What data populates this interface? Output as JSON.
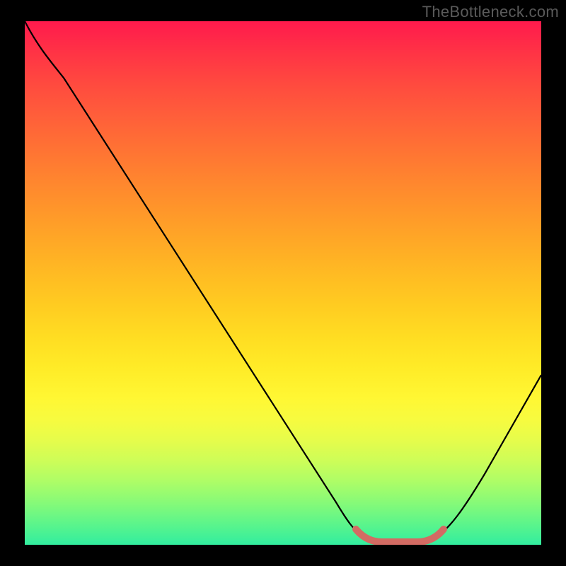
{
  "watermark": "TheBottleneck.com",
  "colors": {
    "frame_bg": "#000000",
    "watermark_text": "#5a5a5a",
    "curve_main": "#000000",
    "curve_bottom": "#d36b63"
  },
  "chart_data": {
    "type": "line",
    "title": "",
    "xlabel": "",
    "ylabel": "",
    "xlim": [
      0,
      100
    ],
    "ylim": [
      0,
      100
    ],
    "series": [
      {
        "name": "bottleneck-curve",
        "x": [
          0,
          3,
          8,
          15,
          25,
          35,
          45,
          55,
          60,
          64,
          67,
          73,
          77,
          80,
          85,
          92,
          100
        ],
        "y": [
          100,
          96,
          92,
          85,
          72,
          58,
          44,
          30,
          20,
          10,
          2,
          0,
          0,
          2,
          8,
          18,
          32
        ]
      },
      {
        "name": "bottom-tolerance-band",
        "x": [
          64,
          67,
          73,
          77,
          80
        ],
        "y": [
          3,
          1,
          0,
          1,
          3
        ]
      }
    ],
    "gradient_stops": [
      {
        "pos": 0,
        "color": "#ff1a4d"
      },
      {
        "pos": 50,
        "color": "#ffc522"
      },
      {
        "pos": 75,
        "color": "#fff733"
      },
      {
        "pos": 100,
        "color": "#32ed9f"
      }
    ]
  }
}
